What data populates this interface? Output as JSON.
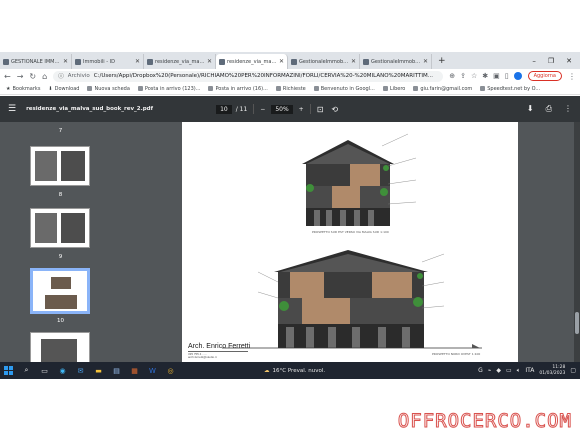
{
  "tabs": [
    {
      "label": "GESTIONALE IMMOBI"
    },
    {
      "label": "Immobili - ID"
    },
    {
      "label": "residenze_via_malva"
    },
    {
      "label": "residenze_via_malva_"
    },
    {
      "label": "GestionaleImmobilia"
    },
    {
      "label": "GestionaleImmobilia"
    }
  ],
  "window_controls": {
    "minimize": "–",
    "restore": "❐",
    "close": "✕"
  },
  "address": {
    "label": "Archivio",
    "url": "C:/Users/Appi/Dropbox%20(Personale)/RICHIAMO%20PER%20INFORMAZINI/FORLI/CERVIA%20-%20MILANO%20MARITTIM..."
  },
  "update_button": "Aggiorna",
  "bookmarks": [
    "Bookmarks",
    "Download",
    "Nuova scheda",
    "Posta in arrivo (123)...",
    "Posta in arrivo (16)...",
    "Richieste",
    "Benvenuto in Googl...",
    "Libero",
    "giu.farin@gmail.com",
    "Speedtest.net by O..."
  ],
  "pdf": {
    "filename": "residenze_via_malva_sud_book_rev_2.pdf",
    "current_page": "10",
    "total_pages": "/ 11",
    "zoom": "50%",
    "thumbnail_labels": [
      "7",
      "8",
      "9",
      "10"
    ]
  },
  "drawing": {
    "architect": "Arch. Enrico Ferretti",
    "architect_sub_1": "335 755 4 ......",
    "architect_sub_2": "arch.ferretti@studio.it",
    "caption_top": "PROSPETTO SUD EST VERSO VIA MALVA SUD 1:100",
    "caption_bottom": "PROSPETTO NORD OVEST 1:100"
  },
  "taskbar": {
    "weather": "16°C  Preval. nuvol.",
    "language": "ITA",
    "time": "11:28",
    "date": "01/03/2023"
  },
  "watermark": "OFFROCERCO.COM"
}
